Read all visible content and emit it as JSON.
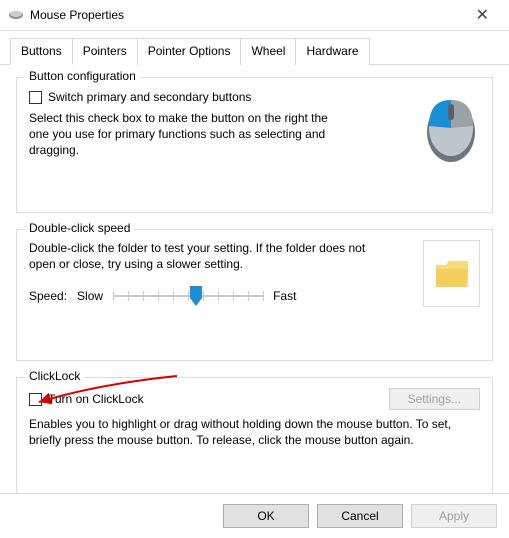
{
  "window": {
    "title": "Mouse Properties"
  },
  "tabs": [
    {
      "label": "Buttons",
      "active": true
    },
    {
      "label": "Pointers",
      "active": false
    },
    {
      "label": "Pointer Options",
      "active": false
    },
    {
      "label": "Wheel",
      "active": false
    },
    {
      "label": "Hardware",
      "active": false
    }
  ],
  "button_config": {
    "title": "Button configuration",
    "checkbox_label": "Switch primary and secondary buttons",
    "checked": false,
    "description": "Select this check box to make the button on the right the one you use for primary functions such as selecting and dragging."
  },
  "double_click": {
    "title": "Double-click speed",
    "description": "Double-click the folder to test your setting. If the folder does not open or close, try using a slower setting.",
    "speed_label": "Speed:",
    "slow_label": "Slow",
    "fast_label": "Fast",
    "slider_value_percent": 55
  },
  "clicklock": {
    "title": "ClickLock",
    "checkbox_label": "Turn on ClickLock",
    "checked": false,
    "settings_button": "Settings...",
    "settings_enabled": false,
    "description": "Enables you to highlight or drag without holding down the mouse button. To set, briefly press the mouse button. To release, click the mouse button again."
  },
  "buttons": {
    "ok": "OK",
    "cancel": "Cancel",
    "apply": "Apply",
    "apply_enabled": false
  },
  "annotation": {
    "arrow_color": "#d40000"
  }
}
